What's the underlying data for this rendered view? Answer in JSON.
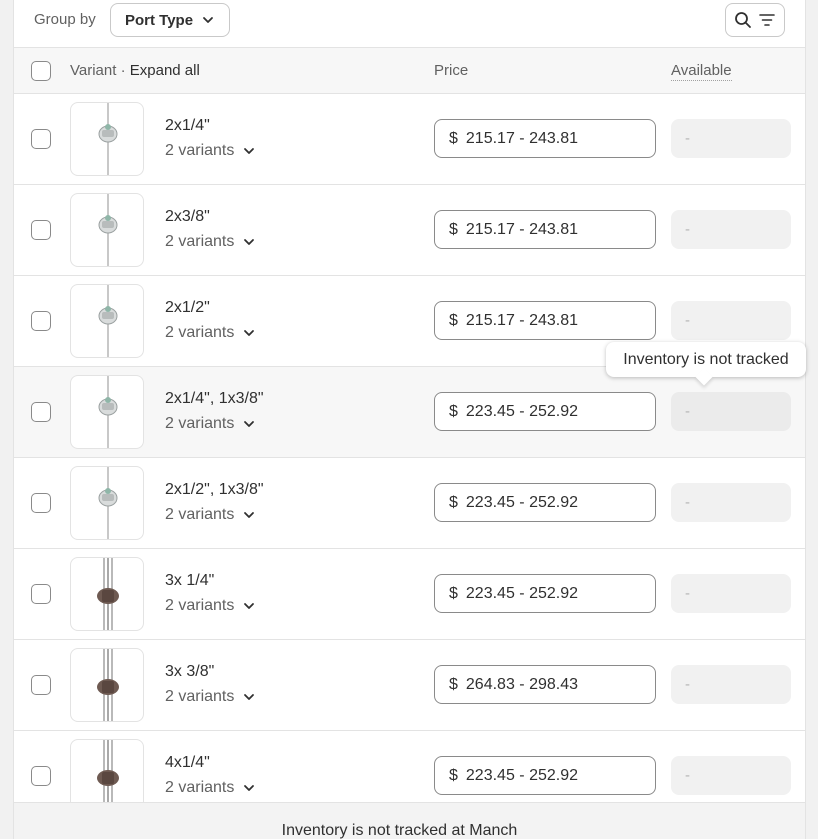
{
  "toolbar": {
    "group_by_label": "Group by",
    "group_by_value": "Port Type"
  },
  "table": {
    "header": {
      "variant": "Variant",
      "separator": " · ",
      "expand_all": "Expand all",
      "price": "Price",
      "available": "Available"
    },
    "rows": [
      {
        "name": "2x1/4\"",
        "variants": "2 variants",
        "currency": "$",
        "price": "215.17 - 243.81",
        "available": "-",
        "thumb": "valve-small"
      },
      {
        "name": "2x3/8\"",
        "variants": "2 variants",
        "currency": "$",
        "price": "215.17 - 243.81",
        "available": "-",
        "thumb": "valve-small"
      },
      {
        "name": "2x1/2\"",
        "variants": "2 variants",
        "currency": "$",
        "price": "215.17 - 243.81",
        "available": "-",
        "thumb": "valve-small"
      },
      {
        "name": "2x1/4\", 1x3/8\"",
        "variants": "2 variants",
        "currency": "$",
        "price": "223.45 - 252.92",
        "available": "-",
        "thumb": "valve-small"
      },
      {
        "name": "2x1/2\", 1x3/8\"",
        "variants": "2 variants",
        "currency": "$",
        "price": "223.45 - 252.92",
        "available": "-",
        "thumb": "valve-small"
      },
      {
        "name": "3x 1/4\"",
        "variants": "2 variants",
        "currency": "$",
        "price": "223.45 - 252.92",
        "available": "-",
        "thumb": "valve-tubes"
      },
      {
        "name": "3x 3/8\"",
        "variants": "2 variants",
        "currency": "$",
        "price": "264.83 - 298.43",
        "available": "-",
        "thumb": "valve-tubes"
      },
      {
        "name": "4x1/4\"",
        "variants": "2 variants",
        "currency": "$",
        "price": "223.45 - 252.92",
        "available": "-",
        "thumb": "valve-tubes"
      }
    ]
  },
  "tooltip": {
    "text": "Inventory is not tracked"
  },
  "footer": {
    "text": "Inventory is not tracked at Manch"
  }
}
